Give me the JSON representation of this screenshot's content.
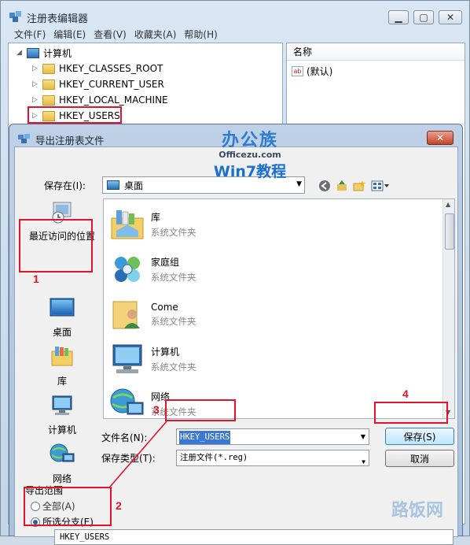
{
  "registry": {
    "title": "注册表编辑器",
    "menu": [
      "文件(F)",
      "编辑(E)",
      "查看(V)",
      "收藏夹(A)",
      "帮助(H)"
    ],
    "tree": {
      "root": "计算机",
      "keys": [
        "HKEY_CLASSES_ROOT",
        "HKEY_CURRENT_USER",
        "HKEY_LOCAL_MACHINE",
        "HKEY_USERS"
      ]
    },
    "values_header": "名称",
    "default_value": "(默认)"
  },
  "dialog": {
    "title": "导出注册表文件",
    "save_in_label": "保存在(I):",
    "save_in_value": "桌面",
    "places": [
      {
        "label": "最近访问的位置",
        "icon": "recent-places-icon"
      },
      {
        "label": "桌面",
        "icon": "desktop-icon"
      },
      {
        "label": "库",
        "icon": "library-icon"
      },
      {
        "label": "计算机",
        "icon": "computer-icon"
      },
      {
        "label": "网络",
        "icon": "network-icon"
      }
    ],
    "files": [
      {
        "name": "库",
        "type": "系统文件夹",
        "icon": "library-icon"
      },
      {
        "name": "家庭组",
        "type": "系统文件夹",
        "icon": "homegroup-icon"
      },
      {
        "name": "Come",
        "type": "系统文件夹",
        "icon": "user-folder-icon"
      },
      {
        "name": "计算机",
        "type": "系统文件夹",
        "icon": "computer-icon"
      },
      {
        "name": "网络",
        "type": "系统文件夹",
        "icon": "network-icon"
      }
    ],
    "filename_label": "文件名(N):",
    "filename_value": "HKEY_USERS",
    "filetype_label": "保存类型(T):",
    "filetype_value": "注册文件(*.reg)",
    "save_button": "保存(S)",
    "cancel_button": "取消",
    "range_title": "导出范围",
    "range_all": "全部(A)",
    "range_selected": "所选分支(E)",
    "branch_value": "HKEY_USERS"
  },
  "annotations": {
    "step1": "1",
    "step2": "2",
    "step3": "3",
    "step4": "4",
    "color": "#e0142c"
  },
  "watermarks": {
    "logo_a": "办公族",
    "logo_b": "Officezu.com",
    "logo_c": "Win7教程",
    "corner": "路饭网"
  }
}
